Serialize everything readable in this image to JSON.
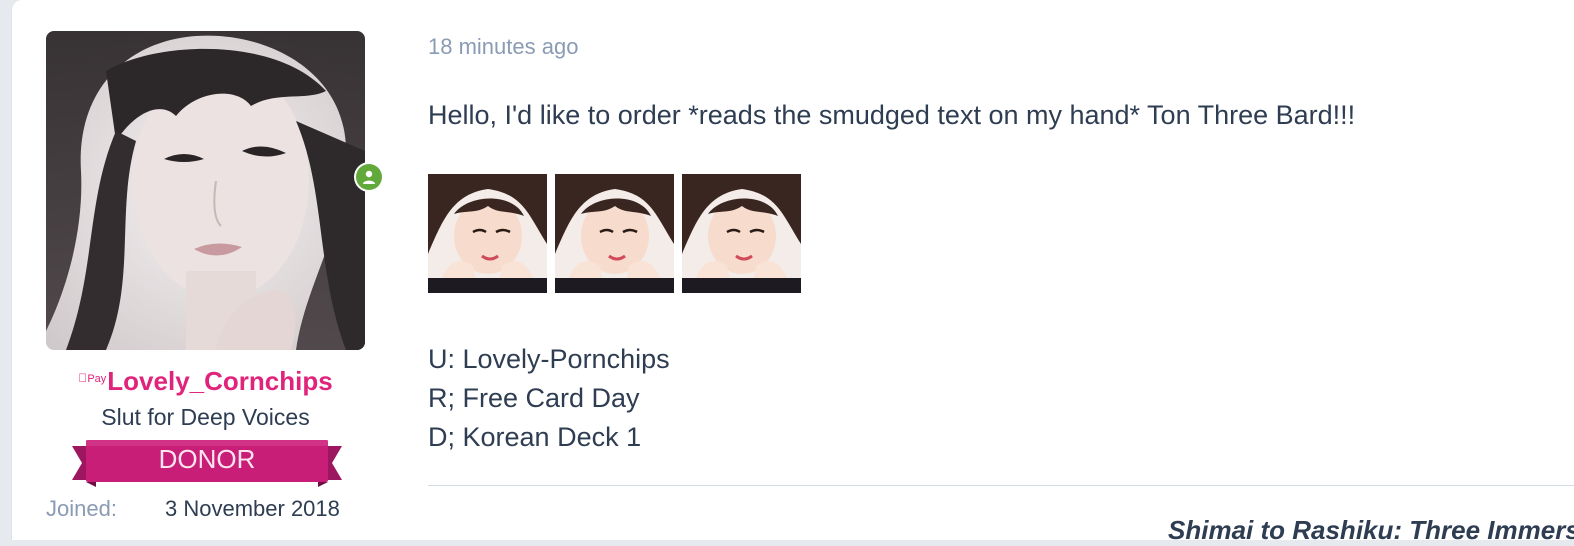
{
  "user": {
    "payment_badge": "Pay",
    "username": "Lovely_Cornchips",
    "title": "Slut for Deep Voices",
    "banner": "DONOR",
    "joined_label": "Joined:",
    "joined_value": "3 November 2018",
    "status": "online",
    "avatar_icon": "user-avatar-photo"
  },
  "post": {
    "timestamp": "18 minutes ago",
    "message": "Hello, I'd like to order *reads the smudged text on my hand* Ton Three Bard!!!",
    "thumbnails": [
      {
        "name": "card-thumbnail-1"
      },
      {
        "name": "card-thumbnail-2"
      },
      {
        "name": "card-thumbnail-3"
      }
    ],
    "order_lines": [
      "U: Lovely-Pornchips",
      "R; Free Card Day",
      "D; Korean Deck 1"
    ],
    "footer_link": "Shimai to Rashiku: Three Immersions"
  },
  "colors": {
    "username": "#e0247c",
    "banner": "#c81e78",
    "online": "#62a93c",
    "text": "#2e3d52",
    "muted": "#8a9bb4"
  }
}
